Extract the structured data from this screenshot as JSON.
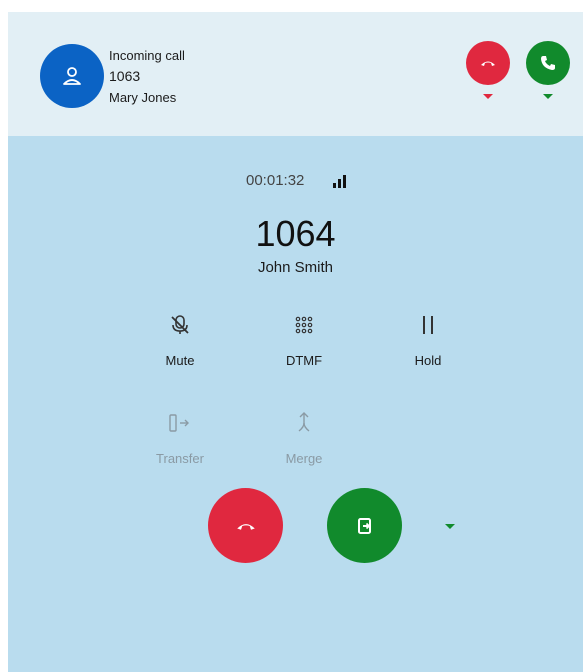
{
  "incoming_call": {
    "title": "Incoming call",
    "number": "1063",
    "name": "Mary Jones"
  },
  "active_call": {
    "timer": "00:01:32",
    "number": "1064",
    "name": "John Smith"
  },
  "controls": {
    "mute": "Mute",
    "dtmf": "DTMF",
    "hold": "Hold",
    "transfer": "Transfer",
    "merge": "Merge"
  },
  "icons": {
    "avatar": "user-icon",
    "decline": "phone-hangup-icon",
    "accept": "phone-icon",
    "signal": "signal-bars-icon",
    "mute": "microphone-off-icon",
    "dtmf": "dialpad-icon",
    "hold": "pause-icon",
    "transfer": "transfer-icon",
    "merge": "merge-icon",
    "transfer_call": "call-transfer-icon",
    "caret": "caret-down-icon"
  },
  "colors": {
    "background": "#b9dcee",
    "incoming_bar": "#e2eff5",
    "avatar": "#0b63c5",
    "decline": "#e0283f",
    "accept": "#118a2c",
    "disabled_text": "#8a9aa4"
  }
}
